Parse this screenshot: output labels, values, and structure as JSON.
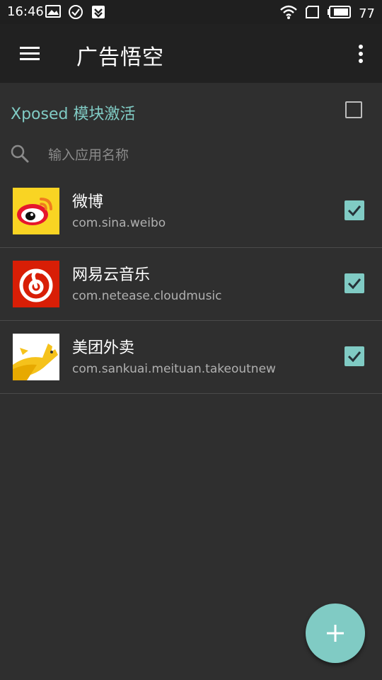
{
  "status_bar": {
    "time": "16:46",
    "battery_level": "77",
    "left_icons": [
      "image-icon",
      "check-circle-icon",
      "download-shield-icon"
    ],
    "right_icons": [
      "wifi-icon",
      "sim-card-icon",
      "battery-icon"
    ]
  },
  "app_bar": {
    "title": "广告悟空",
    "menu_icon": "hamburger-menu-icon",
    "overflow_icon": "more-vert-icon"
  },
  "xposed": {
    "label": "Xposed 模块激活",
    "checked": false
  },
  "search": {
    "placeholder": "输入应用名称",
    "value": ""
  },
  "apps": [
    {
      "name": "微博",
      "package": "com.sina.weibo",
      "checked": true,
      "icon": "weibo-icon"
    },
    {
      "name": "网易云音乐",
      "package": "com.netease.cloudmusic",
      "checked": true,
      "icon": "netease-music-icon"
    },
    {
      "name": "美团外卖",
      "package": "com.sankuai.meituan.takeoutnew",
      "checked": true,
      "icon": "meituan-takeout-icon"
    }
  ],
  "fab": {
    "icon": "add-icon"
  },
  "colors": {
    "accent": "#80cbc4",
    "background": "#2f2f2f",
    "app_bar": "#212121",
    "status_bar": "#1f1f1f"
  }
}
